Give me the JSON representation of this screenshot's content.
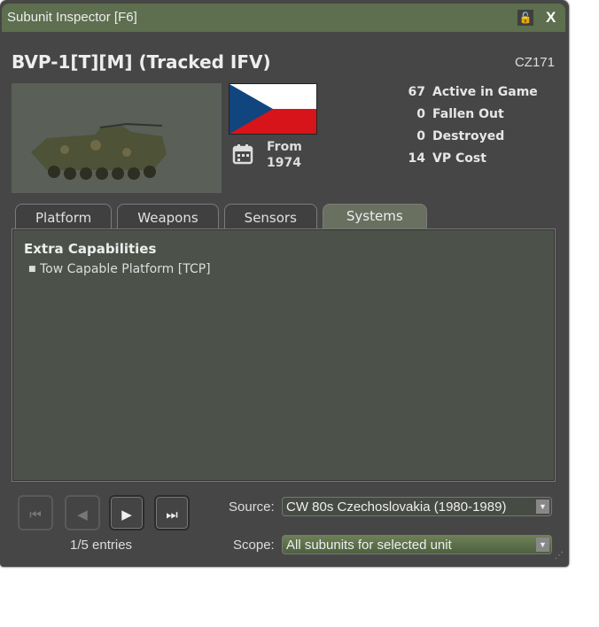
{
  "window": {
    "title": "Subunit Inspector   [F6]",
    "lock_icon": "🔓",
    "close_label": "X"
  },
  "unit": {
    "name": "BVP-1[T][M] (Tracked IFV)",
    "code": "CZ171",
    "from_label": "From",
    "from_year": "1974"
  },
  "stats": [
    {
      "value": "67",
      "label": "Active in Game"
    },
    {
      "value": "0",
      "label": "Fallen Out"
    },
    {
      "value": "0",
      "label": "Destroyed"
    },
    {
      "value": "14",
      "label": "VP Cost"
    }
  ],
  "tabs": [
    "Platform",
    "Weapons",
    "Sensors",
    "Systems"
  ],
  "panel": {
    "heading": "Extra Capabilities",
    "items": [
      "Tow Capable Platform [TCP]"
    ]
  },
  "nav": {
    "first": "⏮",
    "prev": "◀",
    "next": "▶",
    "last": "⏭",
    "entries": "1/5 entries"
  },
  "source": {
    "label": "Source:",
    "value": "CW 80s Czechoslovakia (1980-1989)"
  },
  "scope": {
    "label": "Scope:",
    "value": "All subunits for selected unit"
  },
  "colors": {
    "title_bar": "#5d6f4f",
    "background": "#464646"
  }
}
